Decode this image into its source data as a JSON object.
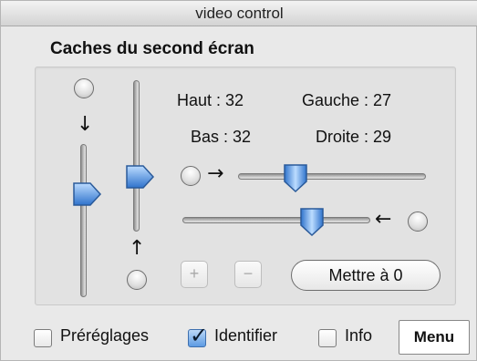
{
  "window": {
    "title": "video control"
  },
  "section": {
    "title": "Caches du second écran"
  },
  "masks": {
    "haut": "Haut : 32",
    "gauche": "Gauche : 27",
    "bas": "Bas : 32",
    "droite": "Droite : 29"
  },
  "arrows": {
    "down": "↓",
    "up": "↑",
    "right": "→",
    "left": "←"
  },
  "buttons": {
    "plus": "+",
    "minus": "−",
    "reset": "Mettre à 0",
    "menu": "Menu"
  },
  "checkboxes": [
    {
      "label": "Préréglages",
      "checked": false
    },
    {
      "label": "Identifier",
      "checked": true
    },
    {
      "label": "Info",
      "checked": false
    }
  ],
  "icons": {
    "check": "✓"
  },
  "colors": {
    "thumb_blue": "#4f8fde",
    "window_bg": "#e9e9e9"
  }
}
